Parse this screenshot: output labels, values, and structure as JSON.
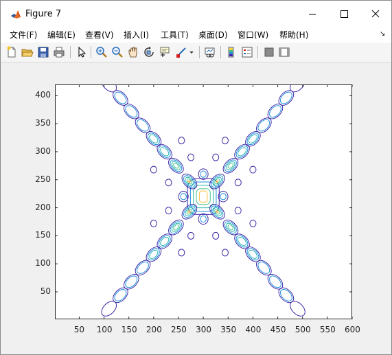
{
  "window": {
    "title": "Figure 7",
    "icon": "matlab-icon",
    "controls": [
      "minimize-icon",
      "maximize-icon",
      "close-icon"
    ]
  },
  "menu": {
    "items": [
      {
        "label": "文件(F)",
        "name": "menu-file"
      },
      {
        "label": "编辑(E)",
        "name": "menu-edit"
      },
      {
        "label": "查看(V)",
        "name": "menu-view"
      },
      {
        "label": "插入(I)",
        "name": "menu-insert"
      },
      {
        "label": "工具(T)",
        "name": "menu-tools"
      },
      {
        "label": "桌面(D)",
        "name": "menu-desktop"
      },
      {
        "label": "窗口(W)",
        "name": "menu-window"
      },
      {
        "label": "帮助(H)",
        "name": "menu-help"
      }
    ],
    "collapse_glyph": "↘"
  },
  "toolbar": {
    "icons": [
      "new-figure-icon",
      "open-file-icon",
      "save-icon",
      "print-icon",
      "edit-plot-icon",
      "zoom-in-icon",
      "zoom-out-icon",
      "pan-icon",
      "rotate-3d-icon",
      "data-cursor-icon",
      "brush-icon",
      "brush-dropdown-icon",
      "link-plot-icon",
      "colorbar-icon",
      "legend-icon",
      "hide-plot-tools-icon",
      "show-plot-tools-icon"
    ]
  },
  "chart_data": {
    "type": "contour",
    "title": "",
    "xlabel": "",
    "ylabel": "",
    "xlim": [
      1,
      600
    ],
    "ylim": [
      1,
      420
    ],
    "x_ticks": [
      50,
      100,
      150,
      200,
      250,
      300,
      350,
      400,
      450,
      500,
      550,
      600
    ],
    "y_ticks": [
      50,
      100,
      150,
      200,
      250,
      300,
      350,
      400
    ],
    "grid": false,
    "colormap": "parula",
    "level_colors": [
      "#3e26a8",
      "#1f90dd",
      "#2ab5b0",
      "#49c48e",
      "#fdbe3d"
    ],
    "center": [
      300,
      220
    ],
    "arm_directions": [
      "upper-left",
      "upper-right",
      "lower-left",
      "lower-right"
    ],
    "arm_blobs": [
      {
        "arm": "upper-left",
        "x": 272,
        "y": 247,
        "levels": 5
      },
      {
        "arm": "upper-left",
        "x": 245,
        "y": 275,
        "levels": 4
      },
      {
        "arm": "upper-left",
        "x": 222,
        "y": 300,
        "levels": 3
      },
      {
        "arm": "upper-left",
        "x": 200,
        "y": 323,
        "levels": 3
      },
      {
        "arm": "upper-left",
        "x": 178,
        "y": 347,
        "levels": 2
      },
      {
        "arm": "upper-left",
        "x": 155,
        "y": 372,
        "levels": 2
      },
      {
        "arm": "upper-left",
        "x": 133,
        "y": 396,
        "levels": 2
      },
      {
        "arm": "upper-left",
        "x": 110,
        "y": 420,
        "levels": 1
      },
      {
        "arm": "upper-right",
        "x": 328,
        "y": 247,
        "levels": 5
      },
      {
        "arm": "upper-right",
        "x": 355,
        "y": 275,
        "levels": 4
      },
      {
        "arm": "upper-right",
        "x": 378,
        "y": 300,
        "levels": 3
      },
      {
        "arm": "upper-right",
        "x": 400,
        "y": 323,
        "levels": 3
      },
      {
        "arm": "upper-right",
        "x": 422,
        "y": 347,
        "levels": 2
      },
      {
        "arm": "upper-right",
        "x": 445,
        "y": 372,
        "levels": 2
      },
      {
        "arm": "upper-right",
        "x": 467,
        "y": 396,
        "levels": 2
      },
      {
        "arm": "upper-right",
        "x": 490,
        "y": 420,
        "levels": 1
      },
      {
        "arm": "lower-left",
        "x": 272,
        "y": 193,
        "levels": 5
      },
      {
        "arm": "lower-left",
        "x": 245,
        "y": 165,
        "levels": 4
      },
      {
        "arm": "lower-left",
        "x": 222,
        "y": 140,
        "levels": 3
      },
      {
        "arm": "lower-left",
        "x": 200,
        "y": 117,
        "levels": 3
      },
      {
        "arm": "lower-left",
        "x": 178,
        "y": 93,
        "levels": 2
      },
      {
        "arm": "lower-left",
        "x": 155,
        "y": 68,
        "levels": 2
      },
      {
        "arm": "lower-left",
        "x": 133,
        "y": 44,
        "levels": 2
      },
      {
        "arm": "lower-left",
        "x": 110,
        "y": 20,
        "levels": 1
      },
      {
        "arm": "lower-right",
        "x": 328,
        "y": 193,
        "levels": 5
      },
      {
        "arm": "lower-right",
        "x": 355,
        "y": 165,
        "levels": 4
      },
      {
        "arm": "lower-right",
        "x": 378,
        "y": 140,
        "levels": 3
      },
      {
        "arm": "lower-right",
        "x": 400,
        "y": 117,
        "levels": 3
      },
      {
        "arm": "lower-right",
        "x": 422,
        "y": 93,
        "levels": 2
      },
      {
        "arm": "lower-right",
        "x": 445,
        "y": 68,
        "levels": 2
      },
      {
        "arm": "lower-right",
        "x": 467,
        "y": 44,
        "levels": 2
      },
      {
        "arm": "lower-right",
        "x": 490,
        "y": 20,
        "levels": 1
      }
    ],
    "satellite_blobs": [
      {
        "x": 300,
        "y": 260,
        "levels": 2
      },
      {
        "x": 300,
        "y": 180,
        "levels": 2
      },
      {
        "x": 260,
        "y": 220,
        "levels": 2
      },
      {
        "x": 340,
        "y": 220,
        "levels": 2
      },
      {
        "x": 275,
        "y": 290,
        "levels": 1
      },
      {
        "x": 325,
        "y": 290,
        "levels": 1
      },
      {
        "x": 275,
        "y": 150,
        "levels": 1
      },
      {
        "x": 325,
        "y": 150,
        "levels": 1
      },
      {
        "x": 230,
        "y": 245,
        "levels": 1
      },
      {
        "x": 370,
        "y": 245,
        "levels": 1
      },
      {
        "x": 230,
        "y": 195,
        "levels": 1
      },
      {
        "x": 370,
        "y": 195,
        "levels": 1
      },
      {
        "x": 256,
        "y": 320,
        "levels": 1
      },
      {
        "x": 344,
        "y": 320,
        "levels": 1
      },
      {
        "x": 256,
        "y": 120,
        "levels": 1
      },
      {
        "x": 344,
        "y": 120,
        "levels": 1
      },
      {
        "x": 200,
        "y": 268,
        "levels": 1
      },
      {
        "x": 400,
        "y": 268,
        "levels": 1
      },
      {
        "x": 200,
        "y": 172,
        "levels": 1
      },
      {
        "x": 400,
        "y": 172,
        "levels": 1
      }
    ]
  }
}
